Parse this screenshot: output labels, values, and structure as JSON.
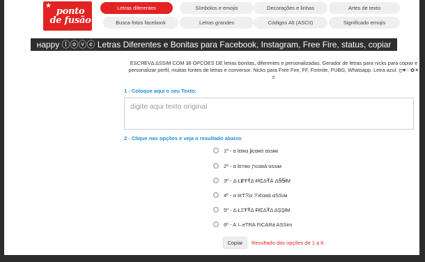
{
  "logo": {
    "line1": "ponto",
    "line2": "de fusão",
    "star": "★"
  },
  "tabs": [
    {
      "label": "Letras diferentes",
      "active": true
    },
    {
      "label": "Símbolos e emojis",
      "active": false
    },
    {
      "label": "Decorações e linhas",
      "active": false
    },
    {
      "label": "Artes de texto",
      "active": false
    },
    {
      "label": "Busca fotos facebook",
      "active": false
    },
    {
      "label": "Letras grandes",
      "active": false
    },
    {
      "label": "Códigos Alt (ASCII)",
      "active": false
    },
    {
      "label": "Significado emojis",
      "active": false
    }
  ],
  "page_title": "нappy ⓛⓞⓥⓔ Letras Diferentes e Bonitas para Facebook, Instagram, Free Fire, status, copiar",
  "description": "ЕЅСЯЕVΔ ΔЅЅІМ СОМ 38 ОРСОЕЅ DЕ letras bonitas, diferentes e personalizadas. Gerador de letras para nicks para copiar e personalizar perfil, muitas fontes de letras e conversor. Nicks para Free Fire, FF, Fortnite, PUBG, Whatsapp. Letra azul. ღ♥♡✿☀ ♬",
  "step1": {
    "label": "1 - Coloque aqui o seu Texto:",
    "placeholder": "digite aqui texto original"
  },
  "step2": {
    "label": "2 - Clique nas opções e veja o resultado abaixo"
  },
  "options": [
    {
      "label": "1º - ɑ lɛtʀɑ ʄɨcɑʀά ɑssɨм"
    },
    {
      "label": "2º - ɑ ℓєтяα ƒιcαяá αѕѕιм"
    },
    {
      "label": "3º - Δ ŁɆŦ₹Δ ₣ł₵Δ₹Á ΔꞨꞨłM"
    },
    {
      "label": "4º - α ℓєƬℛα ℱι¢αяά αЅЅıм"
    },
    {
      "label": "5º - Δ ŁΞŦ₹Δ ₣ł₵Δ₹Δ ΔŞŞłM"
    },
    {
      "label": "6º - A ㄴeTRA FiCARá ASSim"
    }
  ],
  "copy_button": "Copiar",
  "result_text": "Resultado das opções de 1 a 6:"
}
